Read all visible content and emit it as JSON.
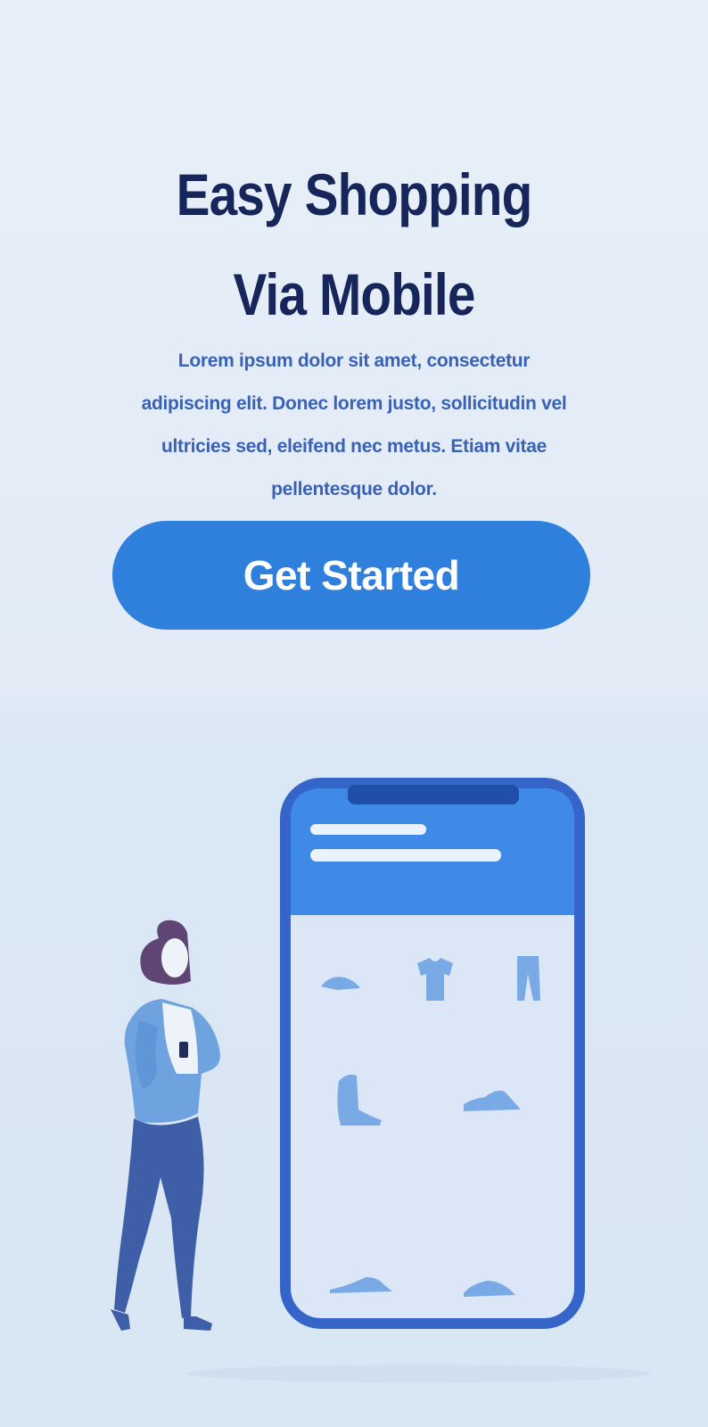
{
  "hero": {
    "title_line1": "Easy Shopping",
    "title_line2": "Via Mobile",
    "body": "Lorem ipsum dolor sit amet, consectetur adipiscing elit. Donec lorem justo, sollicitudin vel ultricies sed, eleifend nec metus. Etiam vitae pellentesque dolor."
  },
  "cta": {
    "label": "Get Started"
  },
  "colors": {
    "title": "#16265a",
    "body_text": "#3a62b4",
    "button": "#2f7fdc",
    "phone_frame": "#3565c8",
    "phone_header": "#3f8ae6"
  },
  "illustration": {
    "subject": "woman-with-smartphone",
    "phone_items": [
      "cap-icon",
      "tshirt-icon",
      "pants-icon",
      "boot-icon",
      "sneaker-icon",
      "shoe-icon",
      "sneaker-icon"
    ]
  }
}
